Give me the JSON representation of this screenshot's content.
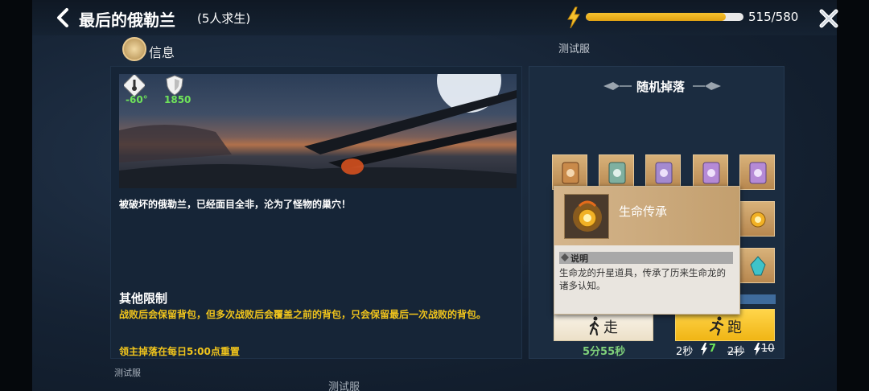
{
  "header": {
    "title": "最后的俄勒兰",
    "subtitle": "(5人求生)",
    "energy": {
      "current": 515,
      "max": 580,
      "text": "515/580",
      "fill_fraction": 0.888
    }
  },
  "server_label_top": "测试服",
  "info": {
    "label": "信息",
    "temperature": "-60°",
    "defense": "1850",
    "description": "被破坏的俄勒兰，已经面目全非，沦为了怪物的巢穴！",
    "limits_title": "其他限制",
    "limits_text": "战败后会保留背包，但多次战败后会覆盖之前的背包，只会保留最后一次战败的背包。",
    "boss_reset": "领主掉落在每日5:00点重置"
  },
  "server_label_bl": "测试服",
  "server_label_bm": "测试服",
  "drops": {
    "title": "随机掉落",
    "items": [
      {
        "icon": "scroll-icon",
        "tint": "#c98a4a"
      },
      {
        "icon": "scroll-icon",
        "tint": "#7fb0a0"
      },
      {
        "icon": "scroll-icon",
        "tint": "#a48ad0"
      },
      {
        "icon": "scroll-icon",
        "tint": "#b58ad6"
      },
      {
        "icon": "scroll-icon",
        "tint": "#b58ad6"
      },
      {
        "icon": "orb-icon",
        "tint": "#f1b125"
      },
      {
        "icon": "crystal-icon",
        "tint": "#3fc3c9"
      }
    ]
  },
  "tooltip": {
    "name": "生命传承",
    "section": "说明",
    "description": "生命龙的升星道具，传承了历来生命龙的诸多认知。"
  },
  "walk": {
    "label": "走",
    "time": "5分55秒"
  },
  "run": {
    "label": "跑",
    "time": "2秒",
    "cost": "7",
    "old_time": "2秒",
    "old_cost": "10"
  },
  "colors": {
    "accent_gold": "#f0c41c",
    "green": "#6fe35a"
  }
}
